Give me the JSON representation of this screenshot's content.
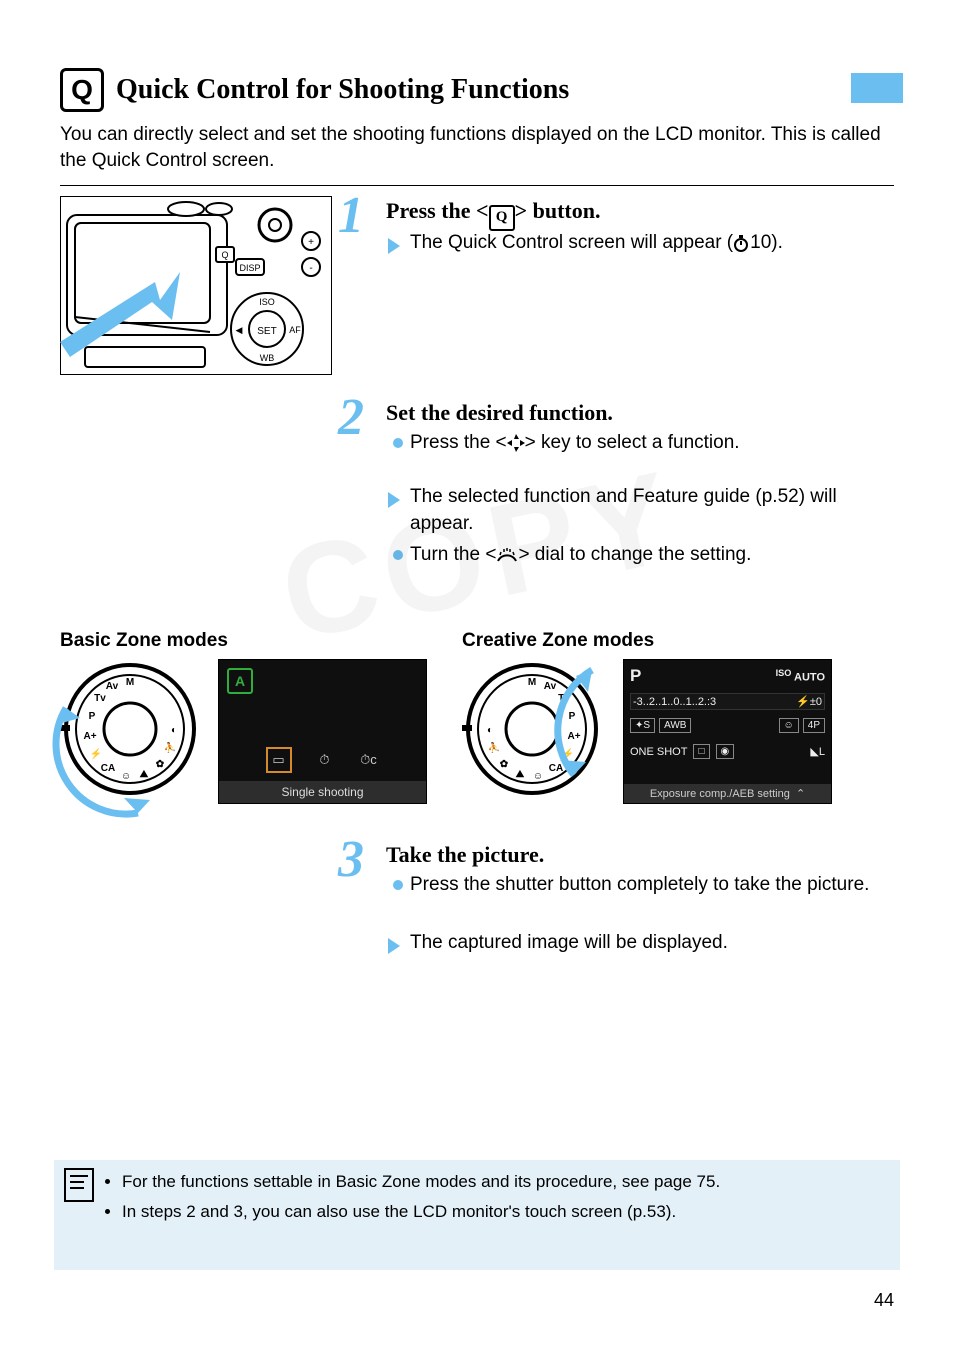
{
  "header": {
    "icon_label": "Q",
    "title": "Quick Control for Shooting Functions"
  },
  "intro": "You can directly select and set the shooting functions displayed on the LCD monitor. This is called the Quick Control screen.",
  "steps": {
    "s1": {
      "num": "1",
      "title_pre": "Press the <",
      "title_icon": "Q",
      "title_post": "> button.",
      "bullet1": "The Quick Control screen will appear (",
      "timer": "10",
      "bullet1_post": ")."
    },
    "s2": {
      "num": "2",
      "title": "Set the desired function.",
      "b1_pre": "Press the <",
      "b1_post": "> key to select a function.",
      "b2": "The selected function and Feature guide (p.52) will appear.",
      "b3_pre": "Turn the <",
      "b3_post": "> dial to change the setting."
    },
    "s3": {
      "num": "3",
      "title": "Take the picture.",
      "b1": "Press the shutter button completely to take the picture.",
      "b2": "The captured image will be displayed."
    }
  },
  "mid": {
    "basic_caption": "Basic Zone modes",
    "creative_caption": "Creative Zone modes",
    "screen1_label": "Single shooting",
    "screen1_mode": "A",
    "screen2_mode": "P",
    "screen2_iso": "AUTO",
    "screen2_iso_prefix": "ISO",
    "screen2_scale": "-3..2..1..0..1..2.:3",
    "screen2_flashcomp": "±0",
    "screen2_pic": "S",
    "screen2_awb": "AWB",
    "screen2_face": "☺",
    "screen2_flash": "4P",
    "screen2_one": "ONE SHOT",
    "screen2_drive": "□",
    "screen2_meter": "◉",
    "screen2_quality": "◣L",
    "screen2_bottom": "Exposure comp./AEB setting",
    "screen2_chev": "⌃"
  },
  "note": {
    "li1": "For the functions settable in Basic Zone modes and its procedure, see page 75.",
    "li2_pre": "In steps 2 and 3, you can also use the LCD monitor's touch screen (",
    "li2_post": ")."
  },
  "pagenum": "44",
  "watermark": "COPY"
}
